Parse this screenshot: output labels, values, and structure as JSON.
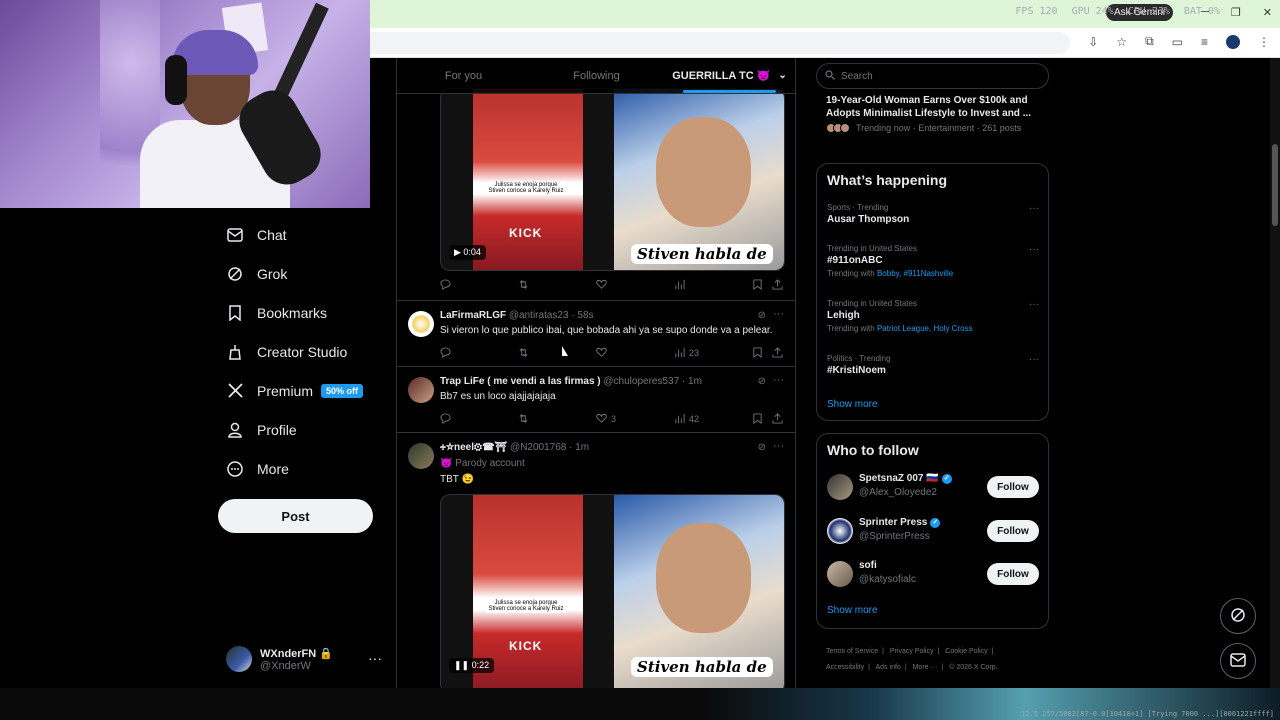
{
  "browser": {
    "hud": [
      "FPS 120",
      "GPU 24%",
      "CPU 23%",
      "BAT 0%"
    ],
    "gemini_label": "Ask Gemini"
  },
  "nav": {
    "items": [
      {
        "label": "Chat",
        "icon": "mail-icon"
      },
      {
        "label": "Grok",
        "icon": "grok-icon"
      },
      {
        "label": "Bookmarks",
        "icon": "bookmark-icon"
      },
      {
        "label": "Creator Studio",
        "icon": "creator-studio-icon"
      },
      {
        "label": "Premium",
        "icon": "x-logo-icon",
        "badge": "50% off"
      },
      {
        "label": "Profile",
        "icon": "person-icon"
      },
      {
        "label": "More",
        "icon": "more-circle-icon"
      }
    ],
    "post_label": "Post"
  },
  "account": {
    "name": "WXnderFN",
    "handle": "@XnderW"
  },
  "tabs": [
    {
      "label": "For you",
      "active": false
    },
    {
      "label": "Following",
      "active": false
    },
    {
      "label": "GUERRILLA TC 👿",
      "active": true
    }
  ],
  "tweets": [
    {
      "name": "LaFirmaRLGF",
      "handle": "@antiratas23 · 58s",
      "text": "Si vieron lo que publico ibai, que bobada ahi ya se supo donde va a pelear.",
      "views": "23",
      "likes": ""
    },
    {
      "name": "Trap LiFe ( me vendi a las firmas )",
      "handle": "@chuloperes537 · 1m",
      "text": "Bb7 es un loco ajajjajajaja",
      "likes": "3",
      "views": "42"
    },
    {
      "name": "🕂☆neel⚙☎⛩",
      "handle": "@N2001768 · 1m",
      "parody": "😈 Parody account",
      "text": "TBT 😉"
    }
  ],
  "video_top": {
    "duration": "0:04",
    "caption": "Stiven habla de",
    "kick": "KICK",
    "subtitle": "Julissa se enoja porque Stiven conoce a Karely Ruiz"
  },
  "video_bottom": {
    "duration": "0:22",
    "caption": "Stiven habla de",
    "kick": "KICK",
    "subtitle": "Julissa se enoja porque Stiven conoce a Karely Ruiz"
  },
  "right": {
    "search_placeholder": "Search",
    "top_trend": {
      "title": "19-Year-Old Woman Earns Over $100k and Adopts Minimalist Lifestyle to Invest and ...",
      "meta": "Trending now · Entertainment · 261 posts"
    },
    "happening_title": "What’s happening",
    "trends": [
      {
        "context": "Sports · Trending",
        "topic": "Ausar Thompson",
        "with_label": "",
        "with": ""
      },
      {
        "context": "Trending in United States",
        "topic": "#911onABC",
        "with_label": "Trending with",
        "with": "Bobby, #911Nashville"
      },
      {
        "context": "Trending in United States",
        "topic": "Lehigh",
        "with_label": "Trending with",
        "with": "Patriot League, Holy Cross"
      },
      {
        "context": "Politics · Trending",
        "topic": "#KristiNoem",
        "with_label": "",
        "with": ""
      }
    ],
    "show_more": "Show more",
    "who_to_follow_title": "Who to follow",
    "follow": [
      {
        "name": "SpetsnaZ 007 🇷🇺",
        "handle": "@Alex_Oloyede2",
        "verified": true
      },
      {
        "name": "Sprinter Press",
        "handle": "@SprinterPress",
        "verified": true
      },
      {
        "name": "sofi",
        "handle": "@katysofialc",
        "verified": false
      }
    ],
    "follow_label": "Follow",
    "footer": [
      "Terms of Service",
      "|",
      "Privacy Policy",
      "|",
      "Cookie Policy",
      "|",
      "Accessibility",
      "|",
      "Ads info",
      "|",
      "More ···",
      "|",
      "© 2026 X Corp."
    ]
  },
  "status_bottom": "12.5 257/5082[87-0.0]10418+1] [Trying 7000 ...][0001221ffff]"
}
